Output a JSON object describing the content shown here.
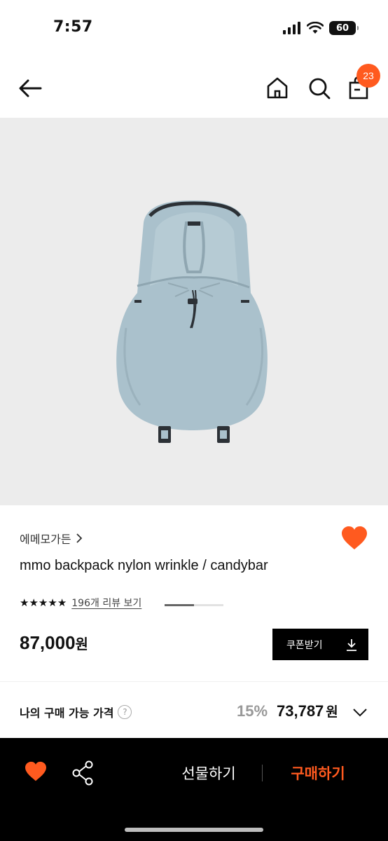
{
  "status_bar": {
    "time": "7:57",
    "battery": "60"
  },
  "header": {
    "cart_count": "23"
  },
  "gallery": {
    "current_page": 1,
    "total_pages": 2
  },
  "product": {
    "brand": "에메모가든",
    "name": "mmo backpack nylon wrinkle / candybar",
    "rating": 5,
    "review_link": "196개 리뷰 보기",
    "price": "87,000",
    "price_unit": "원",
    "liked": true
  },
  "coupon": {
    "label": "쿠폰받기"
  },
  "my_price": {
    "label": "나의 구매 가능 가격",
    "help": "?",
    "discount": "15%",
    "price": "73,787",
    "unit": "원"
  },
  "bottom_bar": {
    "gift_label": "선물하기",
    "buy_label": "구매하기"
  },
  "colors": {
    "accent": "#ff5a1f",
    "bag": "#aac1cc",
    "bar": "#000000"
  }
}
